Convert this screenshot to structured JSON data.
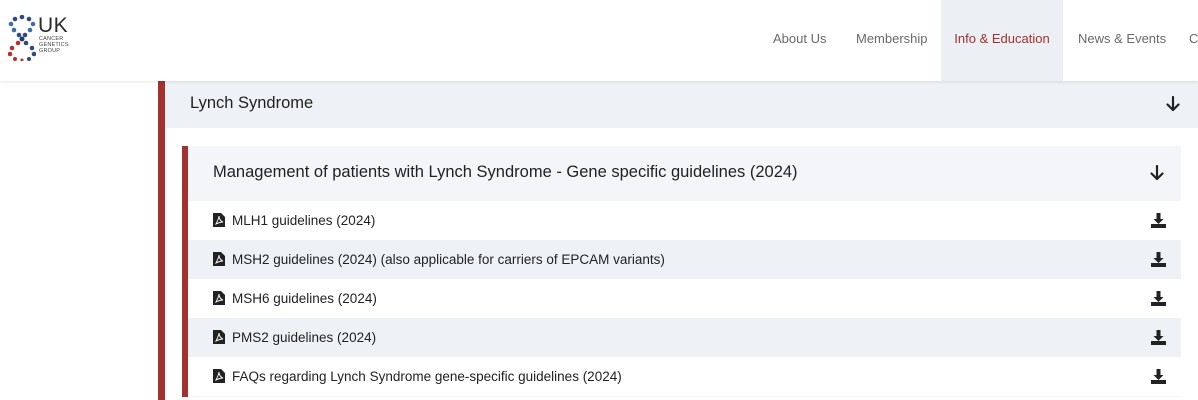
{
  "logo": {
    "title": "UK",
    "subtitle_lines": [
      "CANCER",
      "GENETICS",
      "GROUP"
    ]
  },
  "nav": {
    "items": [
      {
        "label": "About Us"
      },
      {
        "label": "Membership"
      },
      {
        "label": "Info & Education"
      },
      {
        "label": "News & Events"
      },
      {
        "label": "C"
      }
    ]
  },
  "section": {
    "title": "Lynch Syndrome",
    "subsection": {
      "title": "Management of patients with Lynch Syndrome - Gene specific guidelines (2024)",
      "files": [
        {
          "label": "MLH1 guidelines (2024)"
        },
        {
          "label": "MSH2 guidelines (2024) (also applicable for carriers of EPCAM variants)"
        },
        {
          "label": "MSH6 guidelines (2024)"
        },
        {
          "label": "PMS2 guidelines (2024)"
        },
        {
          "label": "FAQs regarding Lynch Syndrome gene-specific guidelines (2024)"
        }
      ]
    }
  },
  "icons": {
    "logo_mark": "dna-helix-logo-icon",
    "expand": "arrow-down-icon",
    "file": "pdf-file-icon",
    "download": "download-icon"
  },
  "colors": {
    "accent": "#a1322f",
    "active_nav_bg": "#eceff4",
    "panel_bg": "#eef1f6",
    "logo_blue": "#2e4a86",
    "logo_red": "#b3312c"
  }
}
